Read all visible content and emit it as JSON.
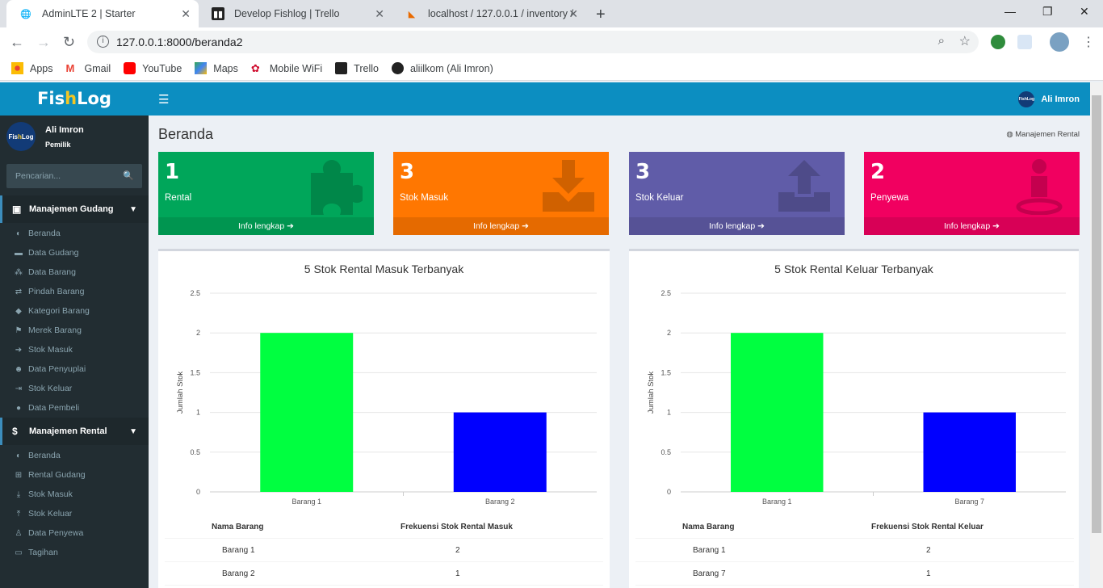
{
  "browser": {
    "tabs": [
      {
        "title": "AdminLTE 2 | Starter",
        "active": true
      },
      {
        "title": "Develop Fishlog | Trello",
        "active": false
      },
      {
        "title": "localhost / 127.0.0.1 / inventory /",
        "active": false
      }
    ],
    "url": "127.0.0.1:8000/beranda2",
    "bookmarks": [
      "Apps",
      "Gmail",
      "YouTube",
      "Maps",
      "Mobile WiFi",
      "Trello",
      "aliilkom (Ali Imron)"
    ]
  },
  "brand": {
    "prefix": "Fis",
    "highlight": "h",
    "suffix": "Log"
  },
  "user": {
    "name": "Ali Imron",
    "role": "Pemilik",
    "avatar_text": "FishLog"
  },
  "search": {
    "placeholder": "Pencarian..."
  },
  "sidebar": {
    "section1": {
      "title": "Manajemen Gudang",
      "items": [
        "Beranda",
        "Data Gudang",
        "Data Barang",
        "Pindah Barang",
        "Kategori Barang",
        "Merek Barang",
        "Stok Masuk",
        "Data Penyuplai",
        "Stok Keluar",
        "Data Pembeli"
      ]
    },
    "section2": {
      "title": "Manajemen Rental",
      "items": [
        "Beranda",
        "Rental Gudang",
        "Stok Masuk",
        "Stok Keluar",
        "Data Penyewa",
        "Tagihan"
      ]
    }
  },
  "page": {
    "title": "Beranda",
    "breadcrumb": "Manajemen Rental"
  },
  "infoboxes": [
    {
      "count": "1",
      "label": "Rental",
      "link": "Info lengkap",
      "color": "#00a65a",
      "icon": "puzzle-icon"
    },
    {
      "count": "3",
      "label": "Stok Masuk",
      "link": "Info lengkap",
      "color": "#ff7701",
      "icon": "download-icon"
    },
    {
      "count": "3",
      "label": "Stok Keluar",
      "link": "Info lengkap",
      "color": "#605ca8",
      "icon": "upload-icon"
    },
    {
      "count": "2",
      "label": "Penyewa",
      "link": "Info lengkap",
      "color": "#f10060",
      "icon": "person-icon"
    }
  ],
  "chart_data": [
    {
      "type": "bar",
      "title": "5 Stok Rental Masuk Terbanyak",
      "categories": [
        "Barang 1",
        "Barang 2"
      ],
      "values": [
        2,
        1
      ],
      "colors": [
        "#00ff40",
        "#0000ff"
      ],
      "ylabel": "Jumlah Stok",
      "xlabel": "",
      "ylim": [
        0,
        2.5
      ],
      "yticks": [
        "0",
        "0.5",
        "1",
        "1.5",
        "2",
        "2.5"
      ],
      "grid": true
    },
    {
      "type": "bar",
      "title": "5 Stok Rental Keluar Terbanyak",
      "categories": [
        "Barang 1",
        "Barang 7"
      ],
      "values": [
        2,
        1
      ],
      "colors": [
        "#00ff40",
        "#0000ff"
      ],
      "ylabel": "Jumlah Stok",
      "xlabel": "",
      "ylim": [
        0,
        2.5
      ],
      "yticks": [
        "0",
        "0.5",
        "1",
        "1.5",
        "2",
        "2.5"
      ],
      "grid": true
    }
  ],
  "tables": [
    {
      "headers": [
        "Nama Barang",
        "Frekuensi Stok Rental Masuk"
      ],
      "rows": [
        [
          "Barang 1",
          "2"
        ],
        [
          "Barang 2",
          "1"
        ]
      ]
    },
    {
      "headers": [
        "Nama Barang",
        "Frekuensi Stok Rental Keluar"
      ],
      "rows": [
        [
          "Barang 1",
          "2"
        ],
        [
          "Barang 7",
          "1"
        ]
      ]
    }
  ]
}
